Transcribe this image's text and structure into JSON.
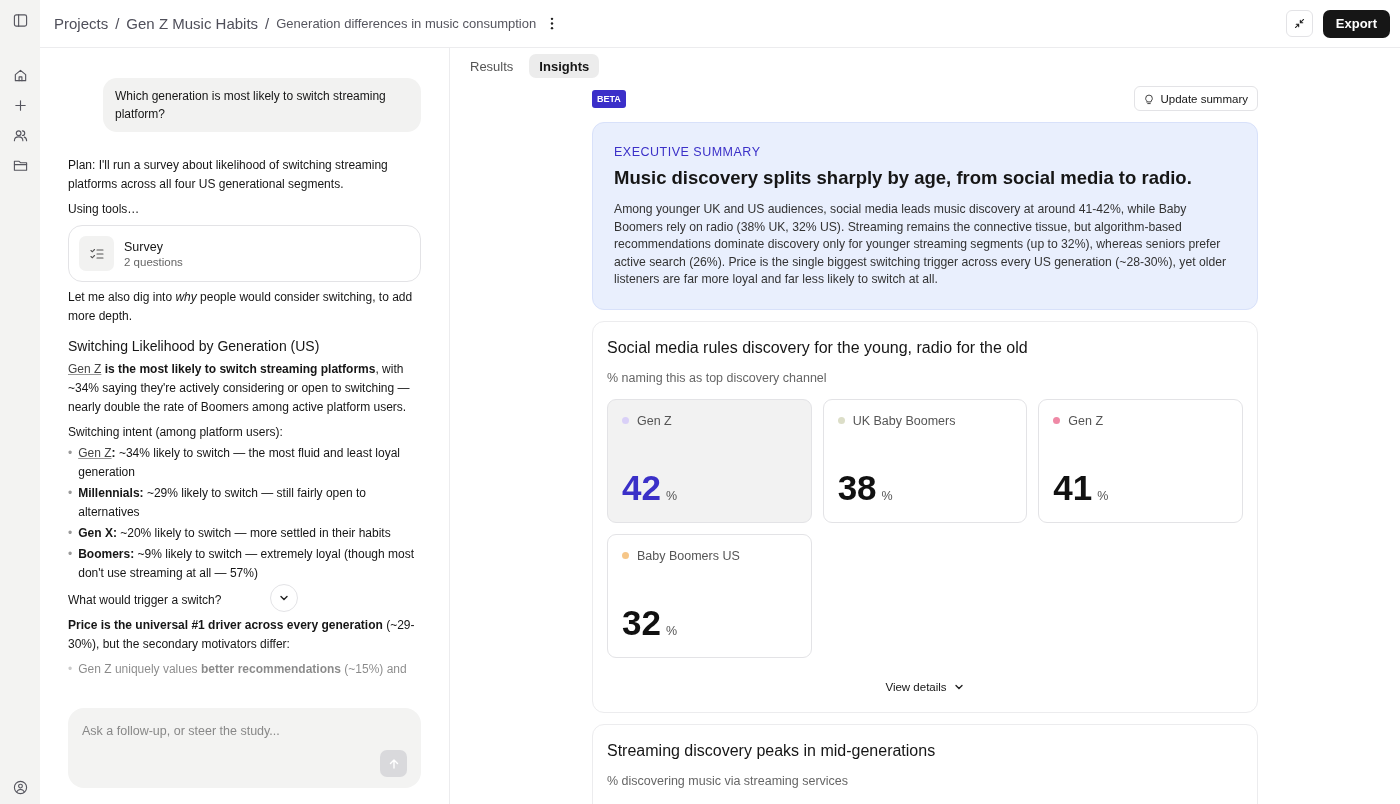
{
  "breadcrumbs": [
    {
      "kind": "crumb",
      "label": "Projects"
    },
    {
      "kind": "separator",
      "label": "/"
    },
    {
      "kind": "crumb",
      "label": "Gen Z Music Habits"
    },
    {
      "kind": "separator",
      "label": "/"
    },
    {
      "kind": "current",
      "label": "Generation differences in music consumption"
    }
  ],
  "header_actions": {
    "export": "Export"
  },
  "chat": {
    "user_message": "Which generation is most likely to switch streaming platform?",
    "items": [
      {
        "kind": "paragraph",
        "text": "Plan: I'll run a survey about likelihood of switching streaming platforms across all four US generational segments."
      },
      {
        "kind": "paragraph",
        "text": "Using tools…"
      },
      {
        "kind": "tool",
        "title": "Survey",
        "subtitle": "2 questions"
      },
      {
        "kind": "paragraph",
        "text": "Let me also dig into *why* people would consider switching, to add more depth."
      },
      {
        "kind": "heading",
        "text": "Switching Likelihood by Generation (US)"
      },
      {
        "kind": "paragraph",
        "link": "Gen Z",
        "text": " **is the most likely to switch streaming platforms**, with ~34% saying they're actively considering or open to switching — nearly double the rate of Boomers among active platform users."
      },
      {
        "kind": "paragraph",
        "text": "Switching intent (among platform users):"
      },
      {
        "kind": "list",
        "faded": false,
        "items": [
          {
            "bullet": "•",
            "link": "Gen Z",
            "text": "**:** ~34% likely to switch — the most fluid and least loyal generation"
          },
          {
            "bullet": "•",
            "text": "**Millennials:** ~29% likely to switch — still fairly open to alternatives"
          },
          {
            "bullet": "•",
            "text": "**Gen X:** ~20% likely to switch — more settled in their habits"
          },
          {
            "bullet": "•",
            "text": "**Boomers:** ~9% likely to switch — extremely loyal (though most don't use streaming at all — 57%)"
          }
        ]
      },
      {
        "kind": "paragraph",
        "text": "What would trigger a switch?"
      },
      {
        "kind": "paragraph",
        "text": "**Price is the universal #1 driver across every generation** (~29-30%), but the secondary motivators differ:"
      },
      {
        "kind": "list",
        "faded": true,
        "items": [
          {
            "bullet": "•",
            "text": "Gen Z uniquely values **better recommendations** (~15%) and"
          }
        ]
      }
    ],
    "input": {
      "placeholder": "Ask a follow-up, or steer the study..."
    }
  },
  "tabs": [
    {
      "label": "Results",
      "selected": false
    },
    {
      "label": "Insights",
      "selected": true
    }
  ],
  "insights": {
    "badge": "BETA",
    "update_button": "Update summary",
    "summary": {
      "label": "EXECUTIVE SUMMARY",
      "title": "Music discovery splits sharply by age, from social media to radio.",
      "body": "Among younger UK and US audiences, social media leads music discovery at around 41-42%, while Baby Boomers rely on radio (38% UK, 32% US). Streaming remains the connective tissue, but algorithm-based recommendations dominate discovery only for younger streaming segments (up to 32%), whereas seniors prefer active search (26%). Price is the single biggest switching trigger across every US generation (~28-30%), yet older listeners are far more loyal and far less likely to switch at all."
    },
    "sections": [
      {
        "title": "Social media rules discovery for the young, radio for the old",
        "subtitle": "% naming this as top discovery channel",
        "details": "View details",
        "stats": [
          {
            "label": "Gen Z",
            "value": "42",
            "unit": "%",
            "color": "#d9d0f7",
            "selected": true
          },
          {
            "label": "UK Baby Boomers",
            "value": "38",
            "unit": "%",
            "color": "#dcdec8",
            "selected": false
          },
          {
            "label": "Gen Z",
            "value": "41",
            "unit": "%",
            "color": "#ef89a6",
            "selected": false
          },
          {
            "label": "Baby Boomers US",
            "value": "32",
            "unit": "%",
            "color": "#f6c688",
            "selected": false
          }
        ]
      },
      {
        "title": "Streaming discovery peaks in mid-generations",
        "subtitle": "% discovering music via streaming services"
      }
    ]
  }
}
